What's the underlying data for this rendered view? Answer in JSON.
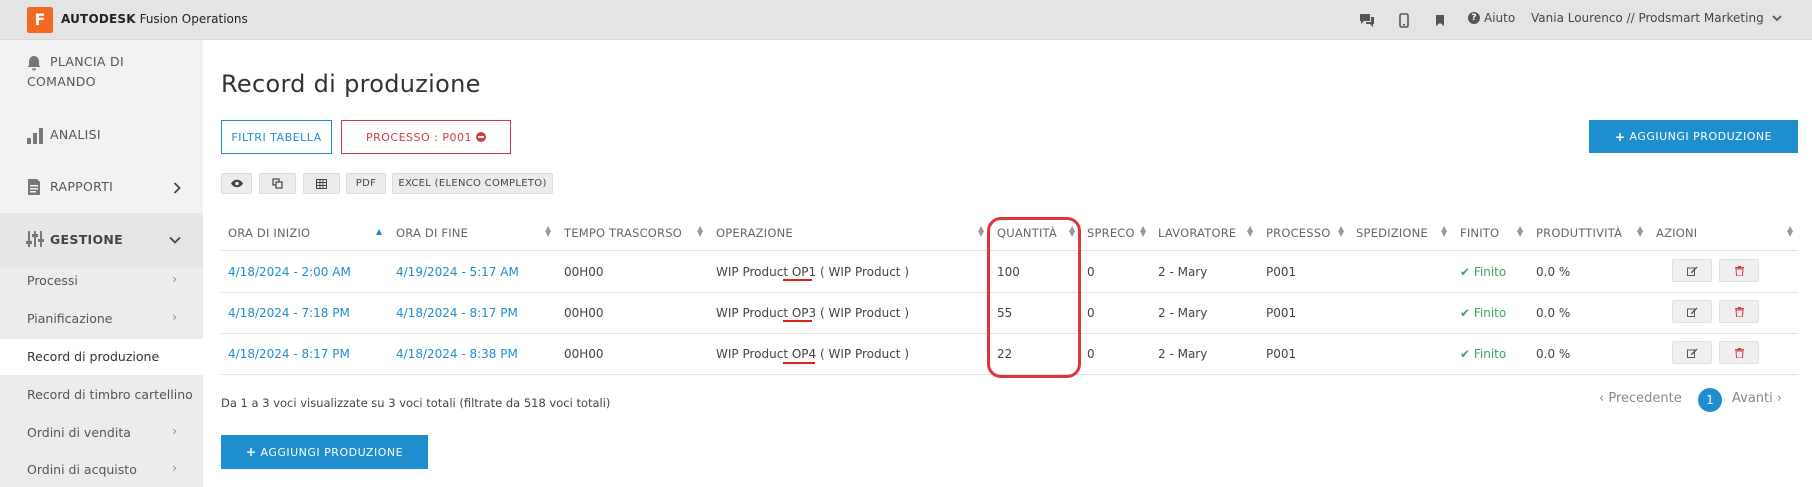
{
  "topbar": {
    "logo_letter": "F",
    "brand_bold": "AUTODESK",
    "brand_rest": "Fusion Operations",
    "icons": [
      "chat-icon",
      "mobile-icon",
      "bookmark-icon"
    ],
    "help_label": "Aiuto",
    "user_label": "Vania Lourenco // Prodsmart Marketing"
  },
  "sidebar": {
    "main_items": [
      {
        "label_line1": "PLANCIA DI",
        "label_line2": "COMANDO",
        "icon": "bell-icon"
      },
      {
        "label": "ANALISI",
        "icon": "bar-chart-icon"
      },
      {
        "label": "RAPPORTI",
        "icon": "report-icon"
      },
      {
        "label": "GESTIONE",
        "icon": "sliders-icon"
      }
    ],
    "sub_items": [
      {
        "label": "Processi",
        "chevron": true
      },
      {
        "label": "Pianificazione",
        "chevron": true
      },
      {
        "label": "Record di produzione",
        "chevron": false
      },
      {
        "label": "Record di timbro cartellino",
        "chevron": false
      },
      {
        "label": "Ordini di vendita",
        "chevron": true
      },
      {
        "label": "Ordini di acquisto",
        "chevron": true
      }
    ]
  },
  "main": {
    "title": "Record di produzione",
    "filter_button": "FILTRI TABELLA",
    "process_filter": "PROCESSO : P001",
    "add_button": "AGGIUNGI PRODUZIONE",
    "tools": {
      "view_icon": "eye-icon",
      "copy_icon": "copy-icon",
      "columns_icon": "grid-icon",
      "pdf": "PDF",
      "excel": "EXCEL (ELENCO COMPLETO)"
    }
  },
  "table": {
    "headers": [
      "ORA DI INIZIO",
      "ORA DI FINE",
      "TEMPO TRASCORSO",
      "OPERAZIONE",
      "QUANTITÀ",
      "SPRECO",
      "LAVORATORE",
      "PROCESSO",
      "SPEDIZIONE",
      "FINITO",
      "PRODUTTIVITÀ",
      "AZIONI"
    ],
    "rows": [
      {
        "start": "4/18/2024 - 2:00 AM",
        "end": "4/19/2024 - 5:17 AM",
        "elapsed": "00H00",
        "op_prefix": "WIP Product ",
        "op_code": "OP1",
        "op_suffix": " ( WIP Product )",
        "qty": "100",
        "waste": "0",
        "worker": "2 - Mary",
        "process": "P001",
        "shipment": "",
        "finished": "Finito",
        "productivity": "0.0 %"
      },
      {
        "start": "4/18/2024 - 7:18 PM",
        "end": "4/18/2024 - 8:17 PM",
        "elapsed": "00H00",
        "op_prefix": "WIP Product ",
        "op_code": "OP3",
        "op_suffix": " ( WIP Product )",
        "qty": "55",
        "waste": "0",
        "worker": "2 - Mary",
        "process": "P001",
        "shipment": "",
        "finished": "Finito",
        "productivity": "0.0 %"
      },
      {
        "start": "4/18/2024 - 8:17 PM",
        "end": "4/18/2024 - 8:38 PM",
        "elapsed": "00H00",
        "op_prefix": "WIP Product ",
        "op_code": "OP4",
        "op_suffix": " ( WIP Product )",
        "qty": "22",
        "waste": "0",
        "worker": "2 - Mary",
        "process": "P001",
        "shipment": "",
        "finished": "Finito",
        "productivity": "0.0 %"
      }
    ],
    "info": "Da 1 a 3 voci visualizzate su 3 voci totali (filtrate da 518 voci totali)"
  },
  "pagination": {
    "prev": "Precedente",
    "current": "1",
    "next": "Avanti"
  },
  "colors": {
    "accent": "#1f8ecf",
    "danger": "#d33a47",
    "success": "#3aa662",
    "brand": "#f26a21",
    "annotation": "#e0343d"
  }
}
